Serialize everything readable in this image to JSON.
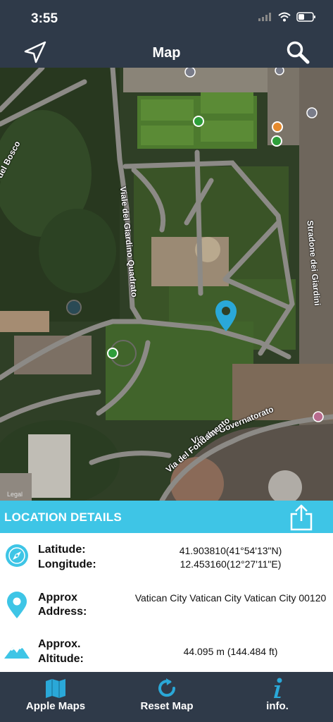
{
  "status": {
    "time": "3:55"
  },
  "nav": {
    "title": "Map",
    "left_icon": "location-arrow-icon",
    "right_icon": "search-icon"
  },
  "map": {
    "labels": {
      "bosco": "ro del Bosco",
      "quadrato": "Viale del Giardino Quadrato",
      "giardini": "Stradone dei Giardini",
      "governatorato": "Via del Governatorato",
      "fondamento": "Via del Fondamento"
    },
    "legal": "Legal",
    "pin_color": "#2aa8d8"
  },
  "details": {
    "header": "LOCATION DETAILS",
    "share_icon": "share-icon",
    "latitude_label": "Latitude:",
    "longitude_label": "Longitude:",
    "latitude_value": "41.903810(41°54'13\"N)",
    "longitude_value": "12.453160(12°27'11\"E)",
    "address_label_1": "Approx",
    "address_label_2": "Address:",
    "address_value": "Vatican City  Vatican City Vatican City 00120",
    "altitude_label_1": "Approx.",
    "altitude_label_2": "Altitude:",
    "altitude_value": "44.095 m (144.484 ft)",
    "accent_color": "#3ec5e6"
  },
  "tabs": {
    "apple_maps": "Apple Maps",
    "reset_map": "Reset Map",
    "info": "info."
  }
}
